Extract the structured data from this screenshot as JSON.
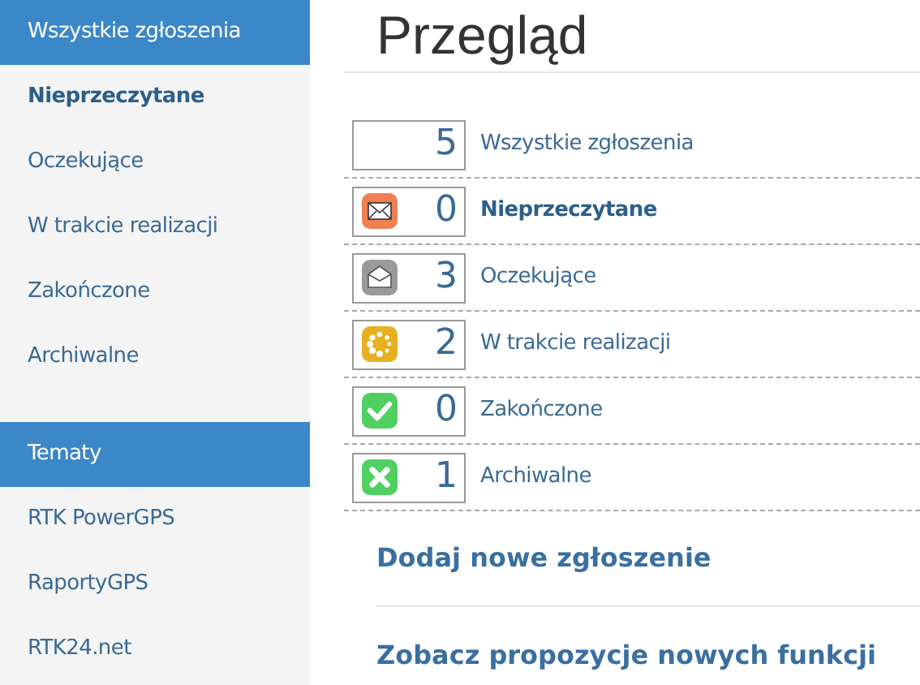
{
  "sidebar": {
    "items": [
      {
        "kind": "header",
        "label": "Wszystkie zgłoszenia"
      },
      {
        "kind": "item",
        "label": "Nieprzeczytane",
        "bold": true
      },
      {
        "kind": "item",
        "label": "Oczekujące",
        "bold": false
      },
      {
        "kind": "item",
        "label": "W trakcie realizacji",
        "bold": false
      },
      {
        "kind": "item",
        "label": "Zakończone",
        "bold": false
      },
      {
        "kind": "item",
        "label": "Archiwalne",
        "bold": false
      },
      {
        "kind": "gap"
      },
      {
        "kind": "header",
        "label": "Tematy"
      },
      {
        "kind": "item",
        "label": "RTK PowerGPS",
        "bold": false
      },
      {
        "kind": "item",
        "label": "RaportyGPS",
        "bold": false
      },
      {
        "kind": "item",
        "label": "RTK24.net",
        "bold": false
      }
    ]
  },
  "title": "Przegląd",
  "stats": [
    {
      "kind": "none",
      "count": "5",
      "label": "Wszystkie zgłoszenia",
      "bold": false
    },
    {
      "kind": "mail",
      "color": "#f08050",
      "count": "0",
      "label": "Nieprzeczytane",
      "bold": true
    },
    {
      "kind": "mail-open",
      "color": "#9a9a9a",
      "count": "3",
      "label": "Oczekujące",
      "bold": false
    },
    {
      "kind": "spinner",
      "color": "#e8b020",
      "count": "2",
      "label": "W trakcie realizacji",
      "bold": false
    },
    {
      "kind": "check",
      "color": "#50d060",
      "count": "0",
      "label": "Zakończone",
      "bold": false
    },
    {
      "kind": "cross",
      "color": "#50d060",
      "count": "1",
      "label": "Archiwalne",
      "bold": false
    }
  ],
  "links": [
    "Dodaj nowe zgłoszenie",
    "Zobacz propozycje nowych funkcji"
  ]
}
